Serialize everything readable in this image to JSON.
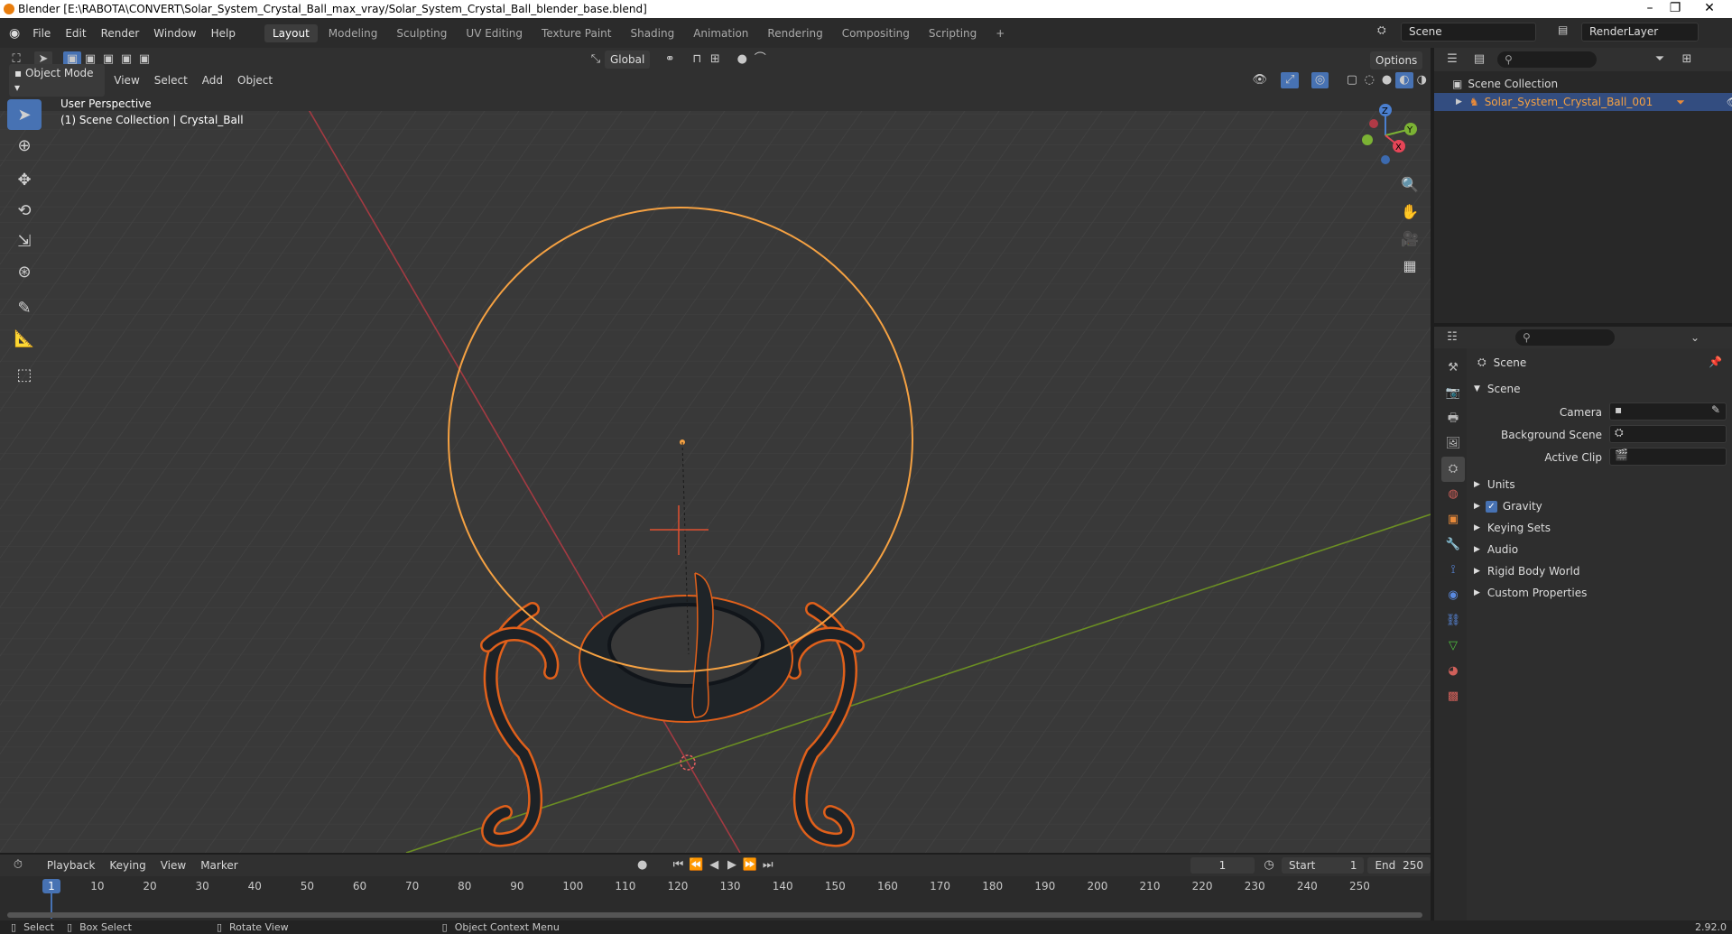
{
  "titlebar": {
    "title": "Blender [E:\\RABOTA\\CONVERT\\Solar_System_Crystal_Ball_max_vray/Solar_System_Crystal_Ball_blender_base.blend]"
  },
  "menubar": {
    "menus": [
      "File",
      "Edit",
      "Render",
      "Window",
      "Help"
    ],
    "workspaces": [
      "Layout",
      "Modeling",
      "Sculpting",
      "UV Editing",
      "Texture Paint",
      "Shading",
      "Animation",
      "Rendering",
      "Compositing",
      "Scripting"
    ],
    "add_workspace": "+",
    "scene": "Scene",
    "render_layer": "RenderLayer"
  },
  "viewport_header": {
    "orientation": "Global",
    "options": "Options",
    "mode": "Object Mode",
    "menus": [
      "View",
      "Select",
      "Add",
      "Object"
    ]
  },
  "viewport": {
    "perspective": "User Perspective",
    "collection": "(1) Scene Collection | Crystal_Ball",
    "gizmo_labels": {
      "z": "Z",
      "y": "Y",
      "x": "X"
    }
  },
  "outliner": {
    "root": "Scene Collection",
    "items": [
      {
        "label": "Solar_System_Crystal_Ball_001"
      }
    ]
  },
  "properties": {
    "breadcrumb": "Scene",
    "panel_title": "Scene",
    "fields": {
      "camera": "Camera",
      "background_scene": "Background Scene",
      "active_clip": "Active Clip"
    },
    "sections": [
      "Units",
      "Gravity",
      "Keying Sets",
      "Audio",
      "Rigid Body World",
      "Custom Properties"
    ],
    "gravity_checked": true
  },
  "timeline": {
    "menus": [
      "Playback",
      "Keying",
      "View",
      "Marker"
    ],
    "current_frame": "1",
    "start_label": "Start",
    "start": "1",
    "end_label": "End",
    "end": "250",
    "ticks": [
      "1",
      "10",
      "20",
      "30",
      "40",
      "50",
      "60",
      "70",
      "80",
      "90",
      "100",
      "110",
      "120",
      "130",
      "140",
      "150",
      "160",
      "170",
      "180",
      "190",
      "200",
      "210",
      "220",
      "230",
      "240",
      "250"
    ]
  },
  "statusbar": {
    "items": [
      "Select",
      "Box Select",
      "Rotate View",
      "Object Context Menu"
    ],
    "version": "2.92.0"
  },
  "colors": {
    "accent": "#4772b3",
    "selection": "#f5a142",
    "outline": "#e0601b"
  }
}
